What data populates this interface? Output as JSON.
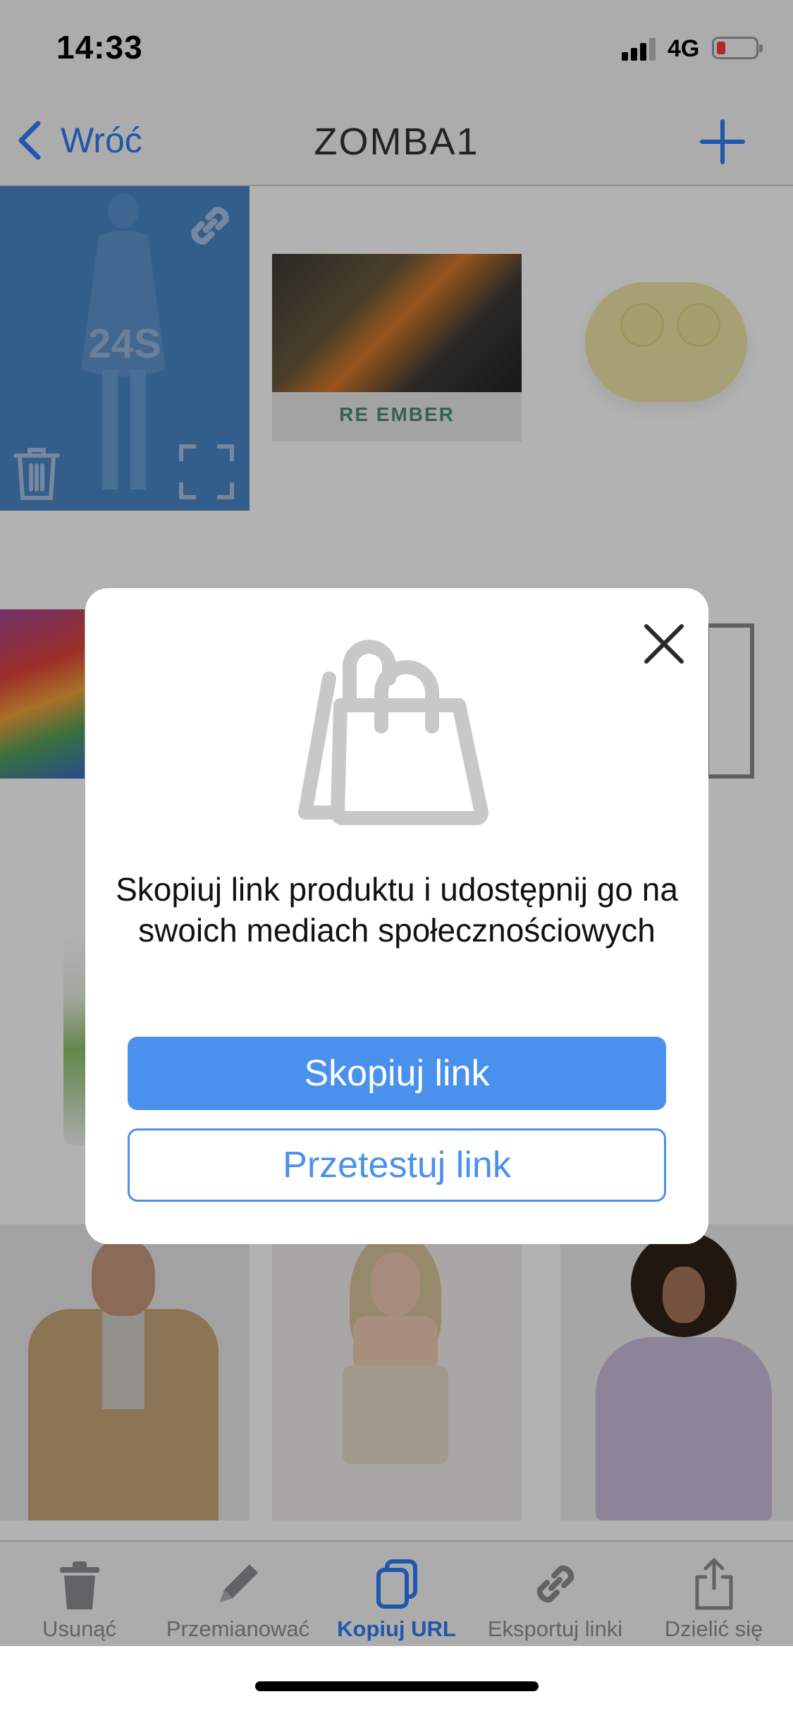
{
  "status_bar": {
    "time": "14:33",
    "network": "4G"
  },
  "nav": {
    "back_label": "Wróć",
    "title": "ZOMBA1"
  },
  "grid": {
    "tile1_brand": "24S",
    "tile2_logo": "RE EMBER"
  },
  "tab_bar": {
    "items": [
      {
        "label": "Usunąć",
        "icon": "trash-icon"
      },
      {
        "label": "Przemianować",
        "icon": "pencil-icon"
      },
      {
        "label": "Kopiuj URL",
        "icon": "copy-icon",
        "active": true
      },
      {
        "label": "Eksportuj linki",
        "icon": "link-icon"
      },
      {
        "label": "Dzielić się",
        "icon": "share-icon"
      }
    ]
  },
  "modal": {
    "icon": "shopping-bags-icon",
    "message": "Skopiuj link produktu i udostępnij go na swoich mediach społecznościowych",
    "primary_button": "Skopiuj link",
    "secondary_button": "Przetestuj link"
  },
  "colors": {
    "accent": "#2f7cf6",
    "button_primary": "#4a91ee",
    "tile_selected": "#4a86c8"
  }
}
